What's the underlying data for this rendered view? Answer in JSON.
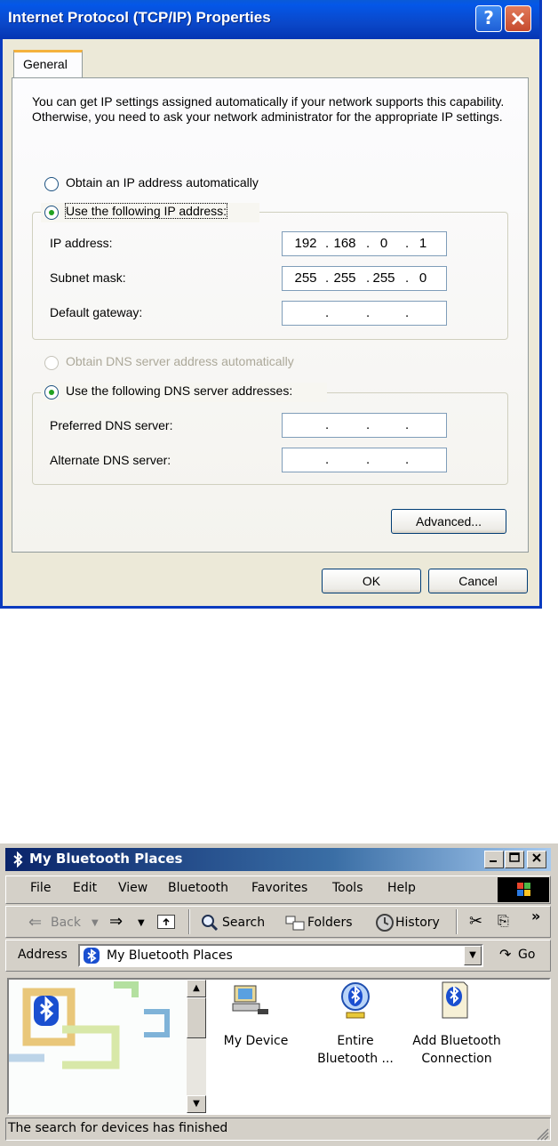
{
  "tcpip": {
    "title": "Internet Protocol (TCP/IP) Properties",
    "help_glyph": "?",
    "close_glyph": "✕",
    "tab_general": "General",
    "intro_text": "You can get IP settings assigned automatically if your network supports this capability. Otherwise, you need to ask your network administrator for the appropriate IP settings.",
    "radio_obtain_ip": {
      "label": "Obtain an IP address automatically",
      "selected": false
    },
    "radio_use_ip": {
      "label": "Use the following IP address:",
      "selected": true
    },
    "ip_address": {
      "label": "IP address:",
      "octets": [
        "192",
        "168",
        "0",
        "1"
      ]
    },
    "subnet_mask": {
      "label": "Subnet mask:",
      "octets": [
        "255",
        "255",
        "255",
        "0"
      ]
    },
    "default_gateway": {
      "label": "Default gateway:",
      "octets": [
        "",
        "",
        "",
        ""
      ]
    },
    "radio_obtain_dns": {
      "label": "Obtain DNS server address automatically",
      "selected": false,
      "disabled": true
    },
    "radio_use_dns": {
      "label": "Use the following DNS server addresses:",
      "selected": true
    },
    "preferred_dns": {
      "label": "Preferred DNS server:",
      "octets": [
        "",
        "",
        "",
        ""
      ]
    },
    "alternate_dns": {
      "label": "Alternate DNS server:",
      "octets": [
        "",
        "",
        "",
        ""
      ]
    },
    "advanced_button": "Advanced...",
    "ok_button": "OK",
    "cancel_button": "Cancel"
  },
  "bluetooth": {
    "title": "My Bluetooth Places",
    "menu": [
      "File",
      "Edit",
      "View",
      "Bluetooth",
      "Favorites",
      "Tools",
      "Help"
    ],
    "toolbar": {
      "back": "Back",
      "search": "Search",
      "folders": "Folders",
      "history": "History",
      "more": "»"
    },
    "address_label": "Address",
    "address_value": "My Bluetooth Places",
    "go_label": "Go",
    "items": [
      {
        "line1": "My Device",
        "line2": ""
      },
      {
        "line1": "Entire",
        "line2": "Bluetooth ..."
      },
      {
        "line1": "Add Bluetooth",
        "line2": "Connection"
      }
    ],
    "status_text": "The search for devices has finished"
  },
  "colors": {
    "xp_title": "#0a47c9",
    "classic_title": "#0a246a",
    "radio_dot": "#21a121",
    "bluetooth_blue": "#1a4fd0"
  }
}
